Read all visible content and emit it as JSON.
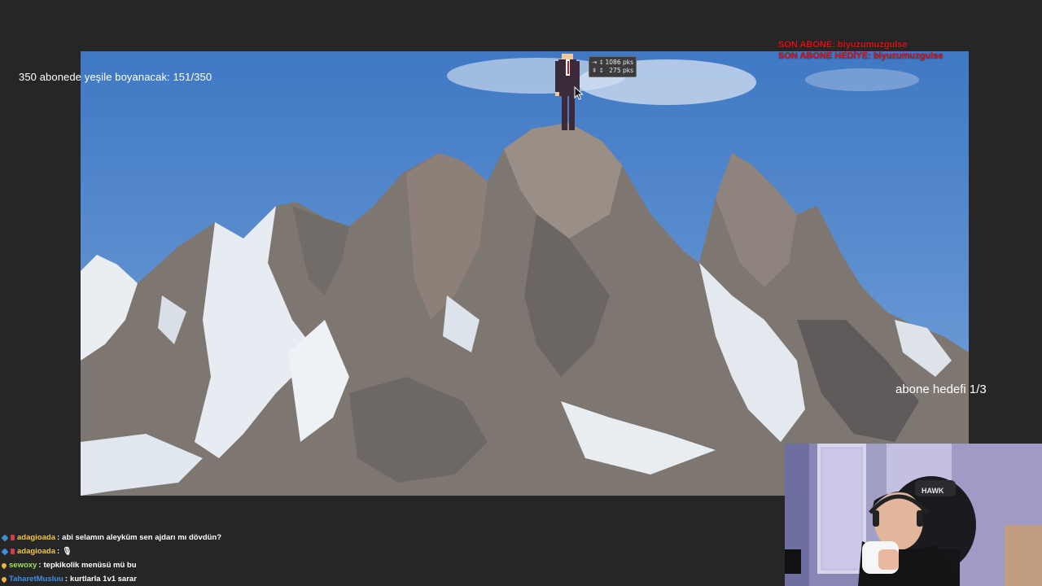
{
  "overlay": {
    "goal_text": "350 abonede yeşile boyanacak: 151/350",
    "abone_hedefi": "abone hedefi 1/3",
    "son_abone": "SON ABONE: biyuzumuzgulse",
    "son_abone_hediye": "SON ABONE HEDİYE: biyuzumuzgulse"
  },
  "measure_tooltip": {
    "horizontal": "1086 pks",
    "vertical": "275 pks"
  },
  "chat": [
    {
      "user": "adagioada",
      "user_color": "#f5c542",
      "message": "abi selamın aleyküm sen ajdarı mı dövdün?",
      "badges": [
        "sub",
        "red"
      ]
    },
    {
      "user": "adagioada",
      "user_color": "#f5c542",
      "message": "🎙",
      "badges": [
        "sub",
        "red"
      ]
    },
    {
      "user": "sewoxy",
      "user_color": "#9ae05a",
      "message": "tepkikolik menüsü mü bu",
      "badges": [
        "drop"
      ]
    },
    {
      "user": "TaharetMusluu",
      "user_color": "#3f8ee8",
      "message": "kurtlarla 1v1 sarar",
      "badges": [
        "drop"
      ]
    }
  ],
  "colors": {
    "background": "#262626",
    "sky": "#4a82c9",
    "alert_red": "#e0141a"
  }
}
